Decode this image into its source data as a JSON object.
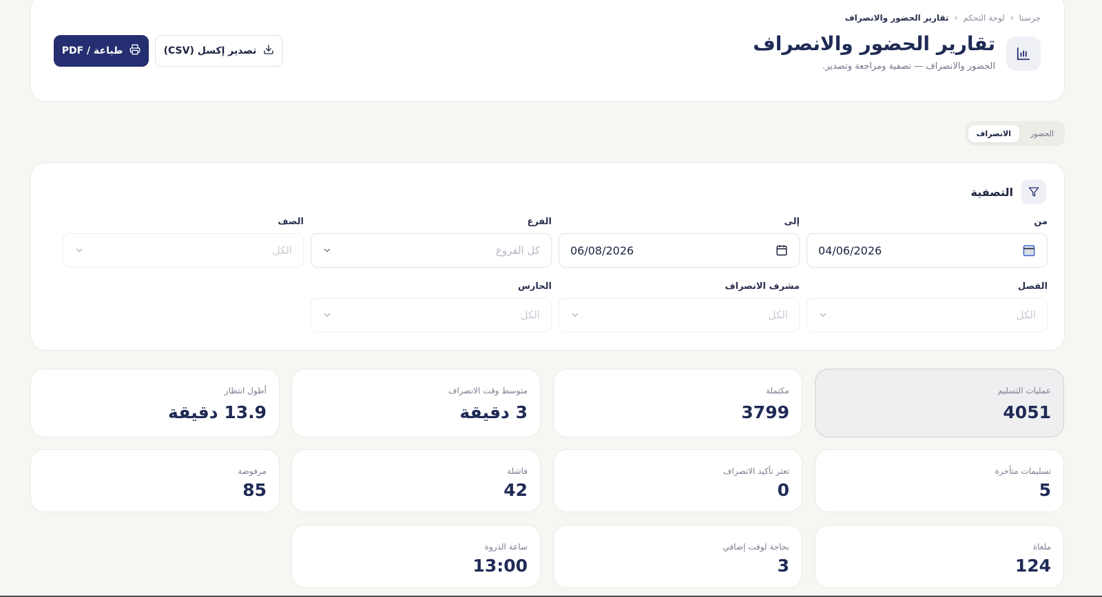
{
  "breadcrumb": {
    "home": "جرسنا",
    "dashboard": "لوحة التحكم",
    "current": "تقارير الحضور والانصراف"
  },
  "header": {
    "title": "تقارير الحضور والانصراف",
    "subtitle": "الحضور والانصراف — تصفية ومراجعة وتصدير.",
    "title_icon": "bar-chart-icon",
    "export_label": "تصدير إكسل (CSV)",
    "export_icon": "download-icon",
    "print_label": "طباعة / PDF",
    "print_icon": "printer-icon"
  },
  "tabs": [
    {
      "label": "الحضور",
      "active": false
    },
    {
      "label": "الانصراف",
      "active": true
    }
  ],
  "filters": {
    "title": "التصفية",
    "icon": "filter-icon",
    "from": {
      "label": "من",
      "value": "04/06/2026"
    },
    "to": {
      "label": "إلى",
      "value": "06/08/2026"
    },
    "branch": {
      "label": "الفرع",
      "placeholder": "كل الفروع"
    },
    "grade": {
      "label": "الصف",
      "placeholder": "الكل"
    },
    "class": {
      "label": "الفصل",
      "placeholder": "الكل"
    },
    "dismissal_supervisor": {
      "label": "مشرف الانصراف",
      "placeholder": "الكل"
    },
    "guard": {
      "label": "الحارس",
      "placeholder": "الكل"
    }
  },
  "stats": [
    {
      "label": "عمليات التسليم",
      "value": "4051"
    },
    {
      "label": "مكتملة",
      "value": "3799"
    },
    {
      "label": "متوسط وقت الانصراف",
      "value": "3 دقيقة"
    },
    {
      "label": "أطول انتظار",
      "value": "13.9 دقيقة"
    },
    {
      "label": "تسليمات متأخرة",
      "value": "5"
    },
    {
      "label": "تعثر تأكيد الانصراف",
      "value": "0"
    },
    {
      "label": "فاشلة",
      "value": "42"
    },
    {
      "label": "مرفوضة",
      "value": "85"
    },
    {
      "label": "ملغاة",
      "value": "124"
    },
    {
      "label": "بحاجة لوقت إضافي",
      "value": "3"
    },
    {
      "label": "ساعة الذروة",
      "value": "13:00"
    }
  ],
  "colors": {
    "primary": "#252e70",
    "title": "#1f2a55",
    "background": "#f7f6f3"
  }
}
